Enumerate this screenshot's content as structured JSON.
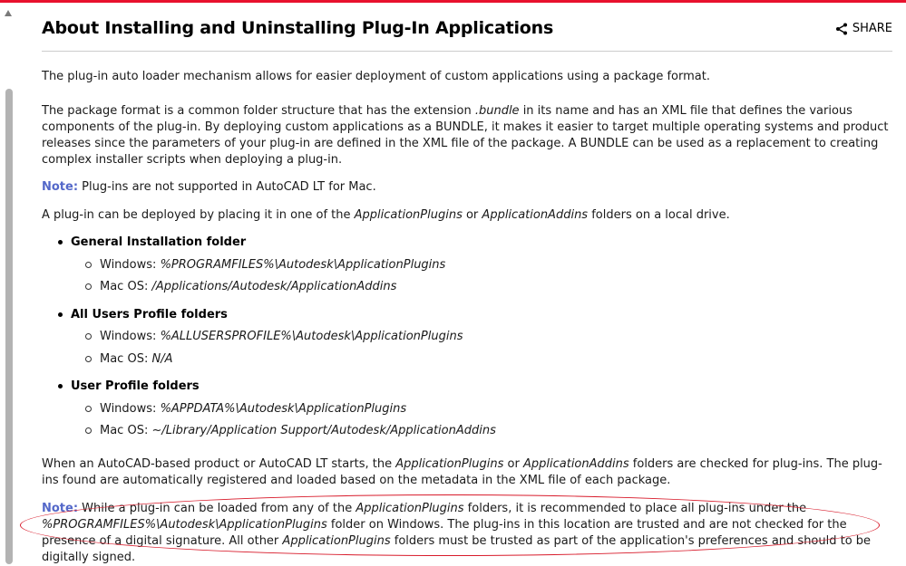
{
  "header": {
    "title": "About Installing and Uninstalling Plug-In Applications",
    "share_label": "SHARE"
  },
  "p1": "The plug-in auto loader mechanism allows for easier deployment of custom applications using a package format.",
  "p2": {
    "a": "The package format is a common folder structure that has the extension ",
    "b": ".bundle",
    "c": " in its name and has an XML file that defines the various components of the plug-in. By deploying custom applications as a BUNDLE, it makes it easier to target multiple operating systems and product releases since the parameters of your plug-in are defined in the XML file of the package. A BUNDLE can be used as a replacement to creating complex installer scripts when deploying a plug-in."
  },
  "note1": {
    "label": "Note:",
    "text": " Plug-ins are not supported in AutoCAD LT for Mac."
  },
  "p4": {
    "a": "A plug-in can be deployed by placing it in one of the ",
    "b": "ApplicationPlugins",
    "c": " or ",
    "d": "ApplicationAddins",
    "e": " folders on a local drive."
  },
  "folders": [
    {
      "title": "General Installation folder",
      "windows_label": "Windows: ",
      "windows_path": "%PROGRAMFILES%\\Autodesk\\ApplicationPlugins",
      "mac_label": "Mac OS: ",
      "mac_path": "/Applications/Autodesk/ApplicationAddins"
    },
    {
      "title": "All Users Profile folders",
      "windows_label": "Windows: ",
      "windows_path": "%ALLUSERSPROFILE%\\Autodesk\\ApplicationPlugins",
      "mac_label": "Mac OS: ",
      "mac_path": "N/A"
    },
    {
      "title": "User Profile folders",
      "windows_label": "Windows: ",
      "windows_path": "%APPDATA%\\Autodesk\\ApplicationPlugins",
      "mac_label": "Mac OS: ",
      "mac_path": "~/Library/Application Support/Autodesk/ApplicationAddins"
    }
  ],
  "p5": {
    "a": "When an AutoCAD-based product or AutoCAD LT starts, the ",
    "b": "ApplicationPlugins",
    "c": " or ",
    "d": "ApplicationAddins",
    "e": " folders are checked for plug-ins. The plug-ins found are automatically registered and loaded based on the metadata in the XML file of each package."
  },
  "note2": {
    "label": "Note:",
    "a": " While a plug-in can be loaded from any of the ",
    "b": "ApplicationPlugins",
    "c": " folders, it is recommended to place all plug-ins under the ",
    "d": "%PROGRAMFILES%\\Autodesk\\ApplicationPlugins",
    "e": " folder on Windows. The plug-ins in this location are trusted and are not checked for the presence of a digital signature. All other ",
    "f": "ApplicationPlugins",
    "g": " folders must be trusted as part of the application's preferences and should to be digitally signed."
  },
  "colors": {
    "accent_top": "#e8112d",
    "note_label": "#5468c9",
    "annotation": "#d81b2b"
  }
}
